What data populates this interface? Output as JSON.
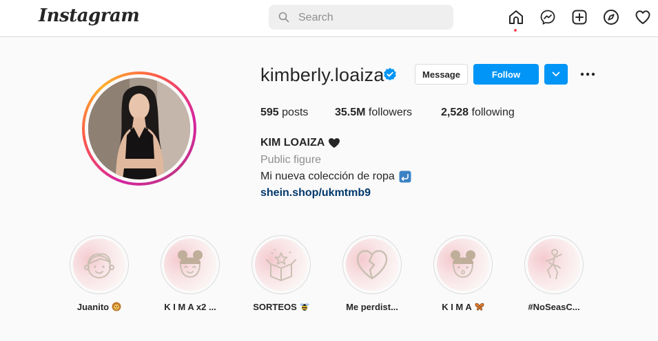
{
  "brand": {
    "logo_text": "Instagram"
  },
  "search": {
    "placeholder": "Search"
  },
  "nav": {
    "icons": [
      "home-icon",
      "messenger-icon",
      "new-post-icon",
      "explore-icon",
      "activity-heart-icon"
    ],
    "active": "home-icon",
    "notification_dot_color": "#ed4956"
  },
  "profile": {
    "username": "kimberly.loaiza",
    "verified": true,
    "buttons": {
      "message": "Message",
      "follow": "Follow"
    },
    "stats": {
      "posts_value": "595",
      "posts_label": "posts",
      "followers_value": "35.5M",
      "followers_label": "followers",
      "following_value": "2,528",
      "following_label": "following"
    },
    "full_name": "KIM LOAIZA",
    "full_name_emoji": "black-heart",
    "category": "Public figure",
    "bio": "Mi nueva colección de ropa",
    "bio_emoji": "return-arrow",
    "link": "shein.shop/ukmtmb9"
  },
  "highlights": [
    {
      "label": "Juanito",
      "emoji": "lion-face",
      "icon": "boy-face-icon"
    },
    {
      "label": "K I M A x2 ...",
      "emoji": "",
      "icon": "girl-face-icon"
    },
    {
      "label": "SORTEOS",
      "emoji": "bee",
      "icon": "gift-box-icon"
    },
    {
      "label": "Me perdist...",
      "emoji": "",
      "icon": "broken-heart-icon"
    },
    {
      "label": "K I M A",
      "emoji": "butterfly",
      "icon": "girl-face-icon"
    },
    {
      "label": "#NoSeasC...",
      "emoji": "",
      "icon": "dancer-icon"
    }
  ],
  "colors": {
    "accent": "#0095f6",
    "link": "#00376b",
    "muted": "#8e8e8e",
    "text": "#262626",
    "highlight_line": "#c9bfb2"
  }
}
